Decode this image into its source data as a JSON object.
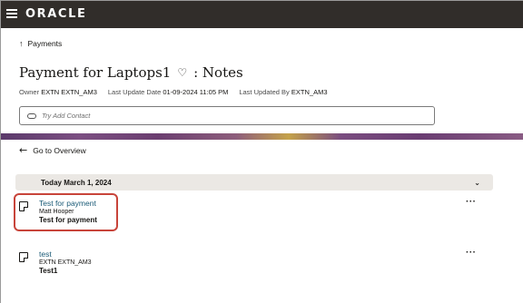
{
  "app": {
    "logo": "ORACLE"
  },
  "breadcrumb": {
    "label": "Payments"
  },
  "header": {
    "title": "Payment for Laptops1",
    "suffix": ": Notes",
    "owner_label": "Owner",
    "owner_value": "EXTN EXTN_AM3",
    "update_label": "Last Update Date",
    "update_value": "01-09-2024 11:05 PM",
    "updated_by_label": "Last Updated By",
    "updated_by_value": "EXTN_AM3"
  },
  "contact": {
    "placeholder": "Try Add Contact"
  },
  "back": {
    "label": "Go to Overview"
  },
  "date_group": {
    "label": "Today March 1, 2024"
  },
  "notes": [
    {
      "title": "Test for payment",
      "author": "Matt Hooper",
      "text": "Test for payment"
    },
    {
      "title": "test",
      "author": "EXTN EXTN_AM3",
      "text": "Test1"
    }
  ],
  "colors": {
    "topbar": "#312d2a",
    "link": "#1a5a76",
    "highlight": "#c8443a"
  }
}
